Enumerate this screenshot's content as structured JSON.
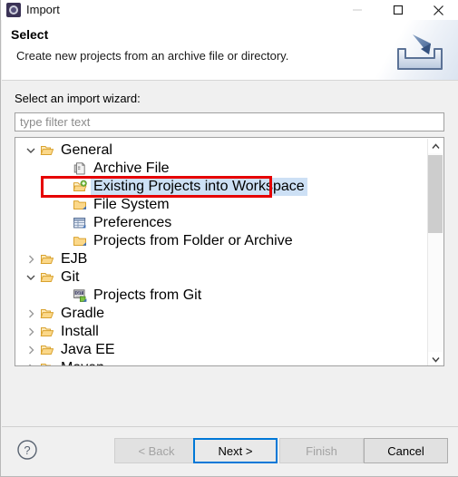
{
  "window": {
    "title": "Import",
    "icon": "eclipse-import-icon",
    "controls": {
      "minimize": "minimize-icon",
      "maximize": "maximize-icon",
      "close": "close-icon"
    }
  },
  "header": {
    "title": "Select",
    "description": "Create new projects from an archive file or directory.",
    "banner_icon": "import-arrow-tray-icon"
  },
  "body": {
    "prompt": "Select an import wizard:",
    "filter": {
      "value": "",
      "placeholder": "type filter text"
    },
    "tree": {
      "selected": "Existing Projects into Workspace",
      "items": [
        {
          "label": "General",
          "level": 0,
          "twisty": "expanded",
          "icon": "open-folder-icon",
          "selected": false
        },
        {
          "label": "Archive File",
          "level": 1,
          "twisty": "none",
          "icon": "archive-file-icon",
          "selected": false
        },
        {
          "label": "Existing Projects into Workspace",
          "level": 1,
          "twisty": "none",
          "icon": "folder-plus-icon",
          "selected": true
        },
        {
          "label": "File System",
          "level": 1,
          "twisty": "none",
          "icon": "folder-icon",
          "selected": false
        },
        {
          "label": "Preferences",
          "level": 1,
          "twisty": "none",
          "icon": "preferences-icon",
          "selected": false
        },
        {
          "label": "Projects from Folder or Archive",
          "level": 1,
          "twisty": "none",
          "icon": "folder-icon",
          "selected": false
        },
        {
          "label": "EJB",
          "level": 0,
          "twisty": "collapsed",
          "icon": "open-folder-icon",
          "selected": false
        },
        {
          "label": "Git",
          "level": 0,
          "twisty": "expanded",
          "icon": "open-folder-icon",
          "selected": false
        },
        {
          "label": "Projects from Git",
          "level": 1,
          "twisty": "none",
          "icon": "git-icon",
          "selected": false
        },
        {
          "label": "Gradle",
          "level": 0,
          "twisty": "collapsed",
          "icon": "open-folder-icon",
          "selected": false
        },
        {
          "label": "Install",
          "level": 0,
          "twisty": "collapsed",
          "icon": "open-folder-icon",
          "selected": false
        },
        {
          "label": "Java EE",
          "level": 0,
          "twisty": "collapsed",
          "icon": "open-folder-icon",
          "selected": false
        },
        {
          "label": "Maven",
          "level": 0,
          "twisty": "collapsed",
          "icon": "open-folder-icon",
          "selected": false
        }
      ]
    },
    "scrollbar": {
      "up": "scroll-up-arrow-icon",
      "down": "scroll-down-arrow-icon"
    }
  },
  "footer": {
    "help": "?",
    "buttons": {
      "back": {
        "label": "< Back",
        "state": "disabled"
      },
      "next": {
        "label": "Next >",
        "state": "focused"
      },
      "finish": {
        "label": "Finish",
        "state": "disabled"
      },
      "cancel": {
        "label": "Cancel",
        "state": "enabled"
      }
    }
  },
  "annotation": {
    "color": "#e60000",
    "target": "Existing Projects into Workspace"
  },
  "colors": {
    "selection": "#cde0f5",
    "focus_border": "#0078d7",
    "annotation": "#e60000",
    "dialog_bg": "#f0f0f0"
  }
}
